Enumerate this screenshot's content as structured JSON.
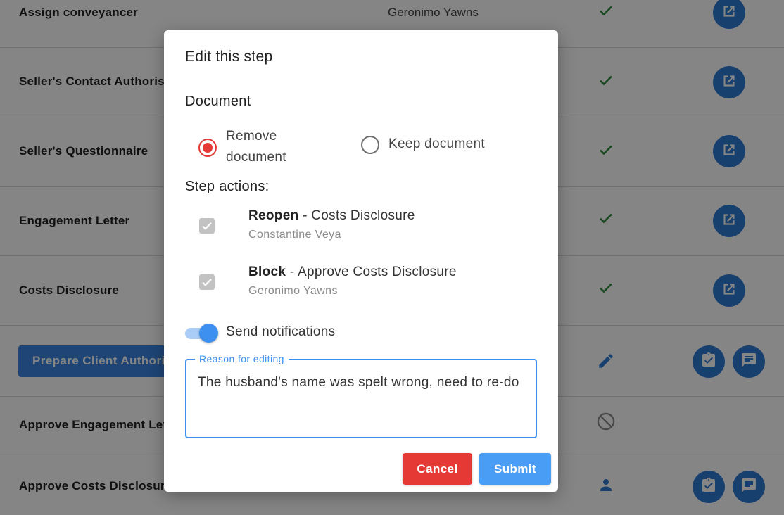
{
  "colors": {
    "primary": "#2f7bd5",
    "success": "#2e8b3a",
    "danger": "#e53935",
    "accent": "#3d8ff0"
  },
  "list": {
    "rows": [
      {
        "title": "Assign conveyancer",
        "assignee": "Geronimo Yawns",
        "status_icon": "check-icon",
        "action_icon": "open-external-icon"
      },
      {
        "title": "Seller's Contact Authorisation",
        "assignee": "",
        "status_icon": "check-icon",
        "action_icon": "open-external-icon"
      },
      {
        "title": "Seller's Questionnaire",
        "assignee": "",
        "status_icon": "check-icon",
        "action_icon": "open-external-icon"
      },
      {
        "title": "Engagement Letter",
        "assignee": "",
        "status_icon": "check-icon",
        "action_icon": "open-external-icon"
      },
      {
        "title": "Costs Disclosure",
        "assignee": "",
        "status_icon": "check-icon",
        "action_icon": "open-external-icon"
      },
      {
        "title": "Prepare Client Authorisation",
        "assignee": "",
        "status_icon": "pencil-icon",
        "action_icons": [
          "clipboard-check-icon",
          "comment-icon"
        ]
      },
      {
        "title": "Approve Engagement Letter",
        "assignee": "",
        "status_icon": "blocked-icon"
      },
      {
        "title": "Approve Costs Disclosure",
        "assignee": "",
        "status_icon": "person-icon",
        "action_icons": [
          "clipboard-check-icon",
          "comment-icon"
        ]
      }
    ]
  },
  "modal": {
    "title": "Edit this step",
    "document_label": "Document",
    "document_options": [
      {
        "line1": "Remove",
        "line2": "document",
        "selected": true
      },
      {
        "label": "Keep document",
        "selected": false
      }
    ],
    "step_actions_label": "Step actions:",
    "actions": [
      {
        "verb": "Reopen",
        "rest": " - Costs Disclosure",
        "person": "Constantine Veya",
        "checked": true
      },
      {
        "verb": "Block",
        "rest": " - Approve Costs Disclosure",
        "person": "Geronimo Yawns",
        "checked": true
      }
    ],
    "notifications_label": "Send notifications",
    "notifications_on": true,
    "reason_label": "Reason for editing",
    "reason_value": "The husband's name was spelt wrong, need to re-do",
    "cancel_label": "Cancel",
    "submit_label": "Submit"
  }
}
